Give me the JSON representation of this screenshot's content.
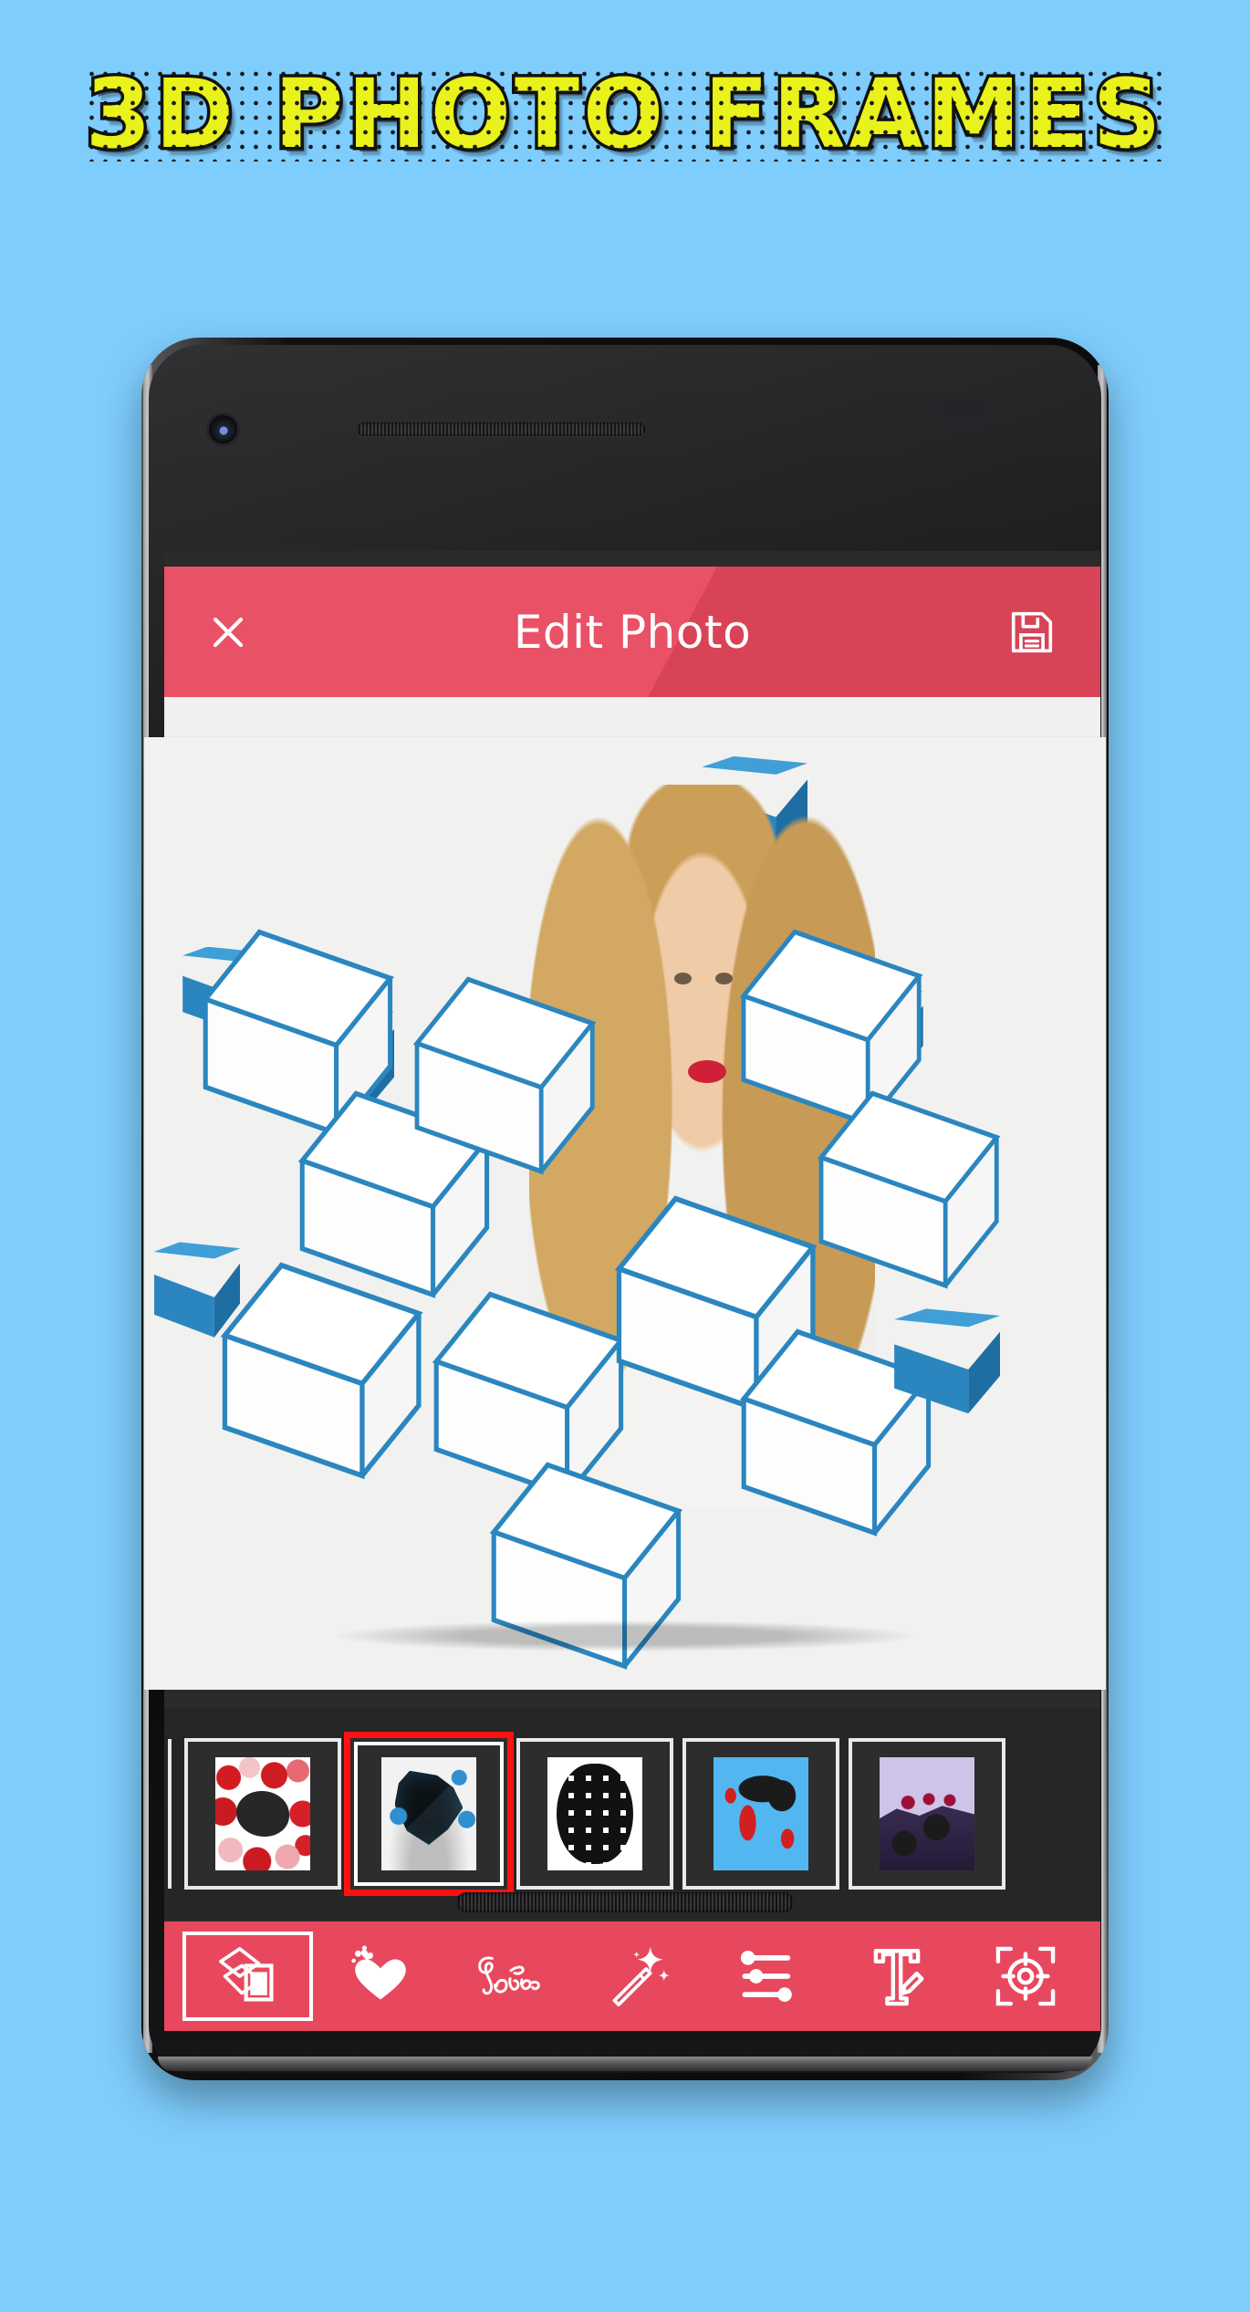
{
  "page": {
    "background_color": "#7ecdfd"
  },
  "promo": {
    "title": "3D PHOTO FRAMES",
    "title_fill_color": "#e9f21a",
    "title_outline_color": "#111111"
  },
  "device": {
    "frame_color": "#0b0b0c",
    "icons": {
      "camera": "front-camera-icon",
      "earpiece": "earpiece-speaker-icon",
      "sensor": "proximity-sensor-icon",
      "bottom_speaker": "bottom-speaker-grille-icon"
    }
  },
  "app": {
    "accent_color": "#e8485e",
    "appbar": {
      "title": "Edit Photo",
      "close_icon": "close-x-icon",
      "close_label": "Close",
      "save_icon": "floppy-save-icon",
      "save_label": "Save"
    },
    "canvas": {
      "background_color": "#f1f1f0",
      "frame_name": "3D Blue Cubes Frame",
      "subject": "Smiling blonde woman in white sleeveless blouse"
    },
    "frames_strip": {
      "selected_index": 1,
      "selection_color": "#ff1111",
      "items": [
        {
          "id": "frame-hearts",
          "label": "Hearts Frame",
          "style": "tb-hearts"
        },
        {
          "id": "frame-cubes",
          "label": "3D Cubes Frame",
          "style": "tb-cubes"
        },
        {
          "id": "frame-globe",
          "label": "Wire Globe Frame",
          "style": "tb-globe"
        },
        {
          "id": "frame-map",
          "label": "World Map Frame",
          "style": "tb-map"
        },
        {
          "id": "frame-purple",
          "label": "Purple Cubes Frame",
          "style": "tb-purple"
        }
      ]
    },
    "toolbar": {
      "selected_index": 0,
      "items": [
        {
          "id": "tool-frames",
          "label": "Frames",
          "icon": "photo-frames-icon"
        },
        {
          "id": "tool-stickers",
          "label": "Stickers",
          "icon": "hearts-sticker-icon"
        },
        {
          "id": "tool-love-text",
          "label": "Love",
          "icon": "love-script-icon"
        },
        {
          "id": "tool-effects",
          "label": "Effects",
          "icon": "magic-wand-icon"
        },
        {
          "id": "tool-adjust",
          "label": "Adjust",
          "icon": "sliders-icon"
        },
        {
          "id": "tool-text",
          "label": "Text",
          "icon": "text-pen-icon"
        },
        {
          "id": "tool-crop",
          "label": "Focus",
          "icon": "crop-target-icon"
        }
      ]
    }
  }
}
